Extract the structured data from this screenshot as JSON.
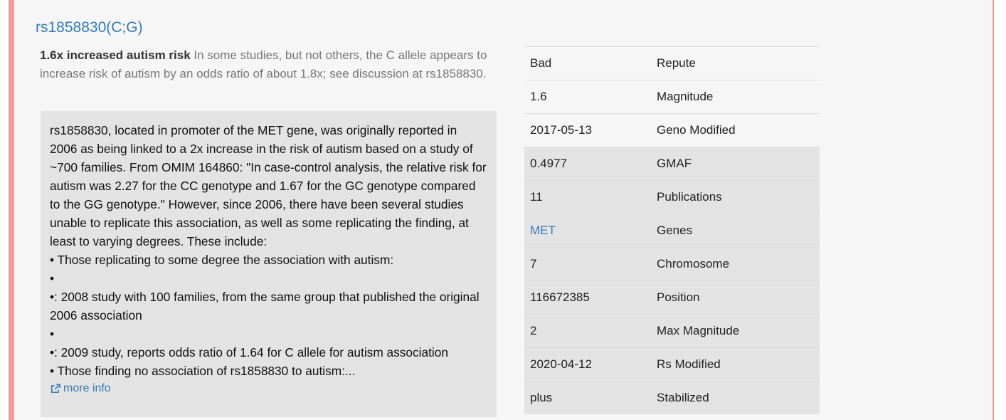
{
  "snp": {
    "title": "rs1858830(C;G)",
    "summary_bold": "1.6x increased autism risk",
    "summary_text": " In some studies, but not others, the C allele appears to increase risk of autism by an odds ratio of about 1.8x; see discussion at rs1858830.",
    "details_lines": [
      "rs1858830, located in promoter of the MET gene, was originally reported in 2006 as being linked to a 2x increase in the risk of autism based on a study of ~700 families. From OMIM 164860: \"In case-control analysis, the relative risk for autism was 2.27 for the CC genotype and 1.67 for the GC genotype compared to the GG genotype.\" However, since 2006, there have been several studies unable to replicate this association, as well as some replicating the finding, at least to varying degrees. These include:",
      "• Those replicating to some degree the association with autism:",
      "•",
      "•: 2008 study with 100 families, from the same group that published the original 2006 association",
      "•",
      "•: 2009 study, reports odds ratio of 1.64 for C allele for autism association",
      "• Those finding no association of rs1858830 to autism:..."
    ],
    "more_info": "more info"
  },
  "info_table": [
    {
      "value": "Bad",
      "label": "Repute"
    },
    {
      "value": "1.6",
      "label": "Magnitude"
    },
    {
      "value": "2017-05-13",
      "label": "Geno Modified"
    },
    {
      "value": "0.4977",
      "label": "GMAF"
    },
    {
      "value": "11",
      "label": "Publications"
    },
    {
      "value": "MET",
      "label": "Genes"
    },
    {
      "value": "7",
      "label": "Chromosome"
    },
    {
      "value": "116672385",
      "label": "Position"
    },
    {
      "value": "2",
      "label": "Max Magnitude"
    },
    {
      "value": "2020-04-12",
      "label": "Rs Modified"
    },
    {
      "value": "plus",
      "label": "Stabilized"
    }
  ],
  "colors": {
    "accent": "#f59a9a",
    "link": "#337ab7",
    "shade": "#e3e3e3"
  },
  "icons": {
    "more_info": "external-link-icon"
  }
}
